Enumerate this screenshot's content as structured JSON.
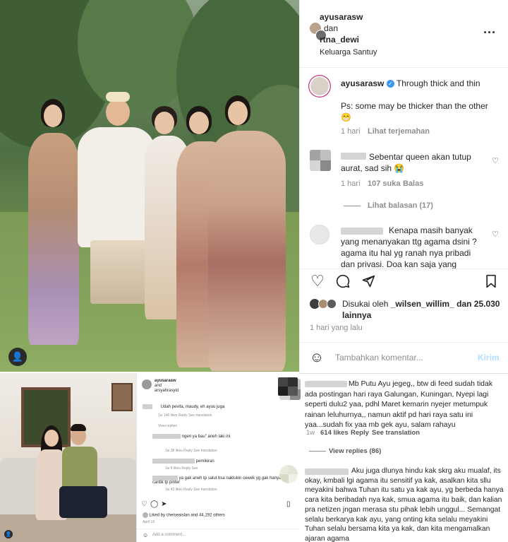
{
  "header": {
    "user1": "ayusarasw",
    "joiner": "dan",
    "user2": "rtna_dewi",
    "location": "Keluarga Santuy",
    "more_icon": "more-horizontal-icon"
  },
  "caption": {
    "username": "ayusarasw",
    "text": "Through thick and thin",
    "text2": "Ps: some may be thicker than the other 😁",
    "time": "1 hari",
    "translate": "Lihat terjemahan"
  },
  "comments": [
    {
      "text": "Sebentar queen akan tutup aurat, sad sih 😭",
      "time": "1 hari",
      "likes": "107 suka",
      "reply": "Balas",
      "view_replies": "Lihat balasan (17)"
    },
    {
      "text": "Kenapa masih banyak yang menanyakan ttg agama dsini ? agama itu hal yg ranah nya pribadi dan privasi. Doa kan saja yang"
    }
  ],
  "actions": {
    "liked_by_prefix": "Disukai oleh",
    "liked_by_user": "_wilsen_willim_",
    "liked_by_suffix": "dan 25.030 lainnya",
    "time": "1 hari yang lalu"
  },
  "add_comment": {
    "placeholder": "Tambahkan komentar...",
    "post": "Kirim"
  },
  "bottom_comments": [
    {
      "text": "Mb Putu Ayu jegeg,, btw di feed sudah tidak ada postingan hari raya Galungan, Kuningan, Nyepi lagi seperti dulu2 yaa, pdhl Maret kemarin nyejer metumpuk rainan leluhurnya,, namun aktif pd hari raya satu ini yaa...sudah fix yaa mb gek ayu, salam rahayu",
      "time": "1w",
      "likes": "614 likes",
      "reply": "Reply",
      "translate": "See translation",
      "view_replies": "View replies (86)"
    },
    {
      "text": "Aku juga dlunya hindu kak skrg aku mualaf, its okay, kmbali lgi agama itu sensitif ya kak, asalkan kita sllu meyakini bahwa Tuhan itu satu ya kak ayu, yg berbeda hanya cara kita beribadah nya kak, smua agama itu baik, dan kalian pra netizen jngan merasa stu pihak lebih unggul... Semangat selalu berkarya kak ayu, yang onting kita selalu meyakini Tuhan selalu bersama kita ya kak, dan kita mengamalkan ajaran agama"
    }
  ],
  "embed": {
    "username": "ayusarasw",
    "joiner": "and",
    "user2": "arsyahrasyid",
    "c1": "Udah pevita, maudy, eh ayuu juga",
    "c1_meta": "1w   146 likes   Reply   See translation",
    "view_replies": "View replies",
    "c2": "ngeri ya bau\" aneh laki ini",
    "c2_meta": "1w   38 likes   Reply   See translation",
    "c3": "pemikiran",
    "c3_meta": "1w   8 likes   Reply   See",
    "c4": "ya gak aneh tp salut bsa naklukin cewek yg gak hanya cantik tp pinter",
    "c4_meta": "1w   43 likes   Reply   See translation",
    "liked_by": "Liked by chelseaislan and 44,192 others",
    "date": "April 19",
    "add_comment": "Add a comment..."
  }
}
